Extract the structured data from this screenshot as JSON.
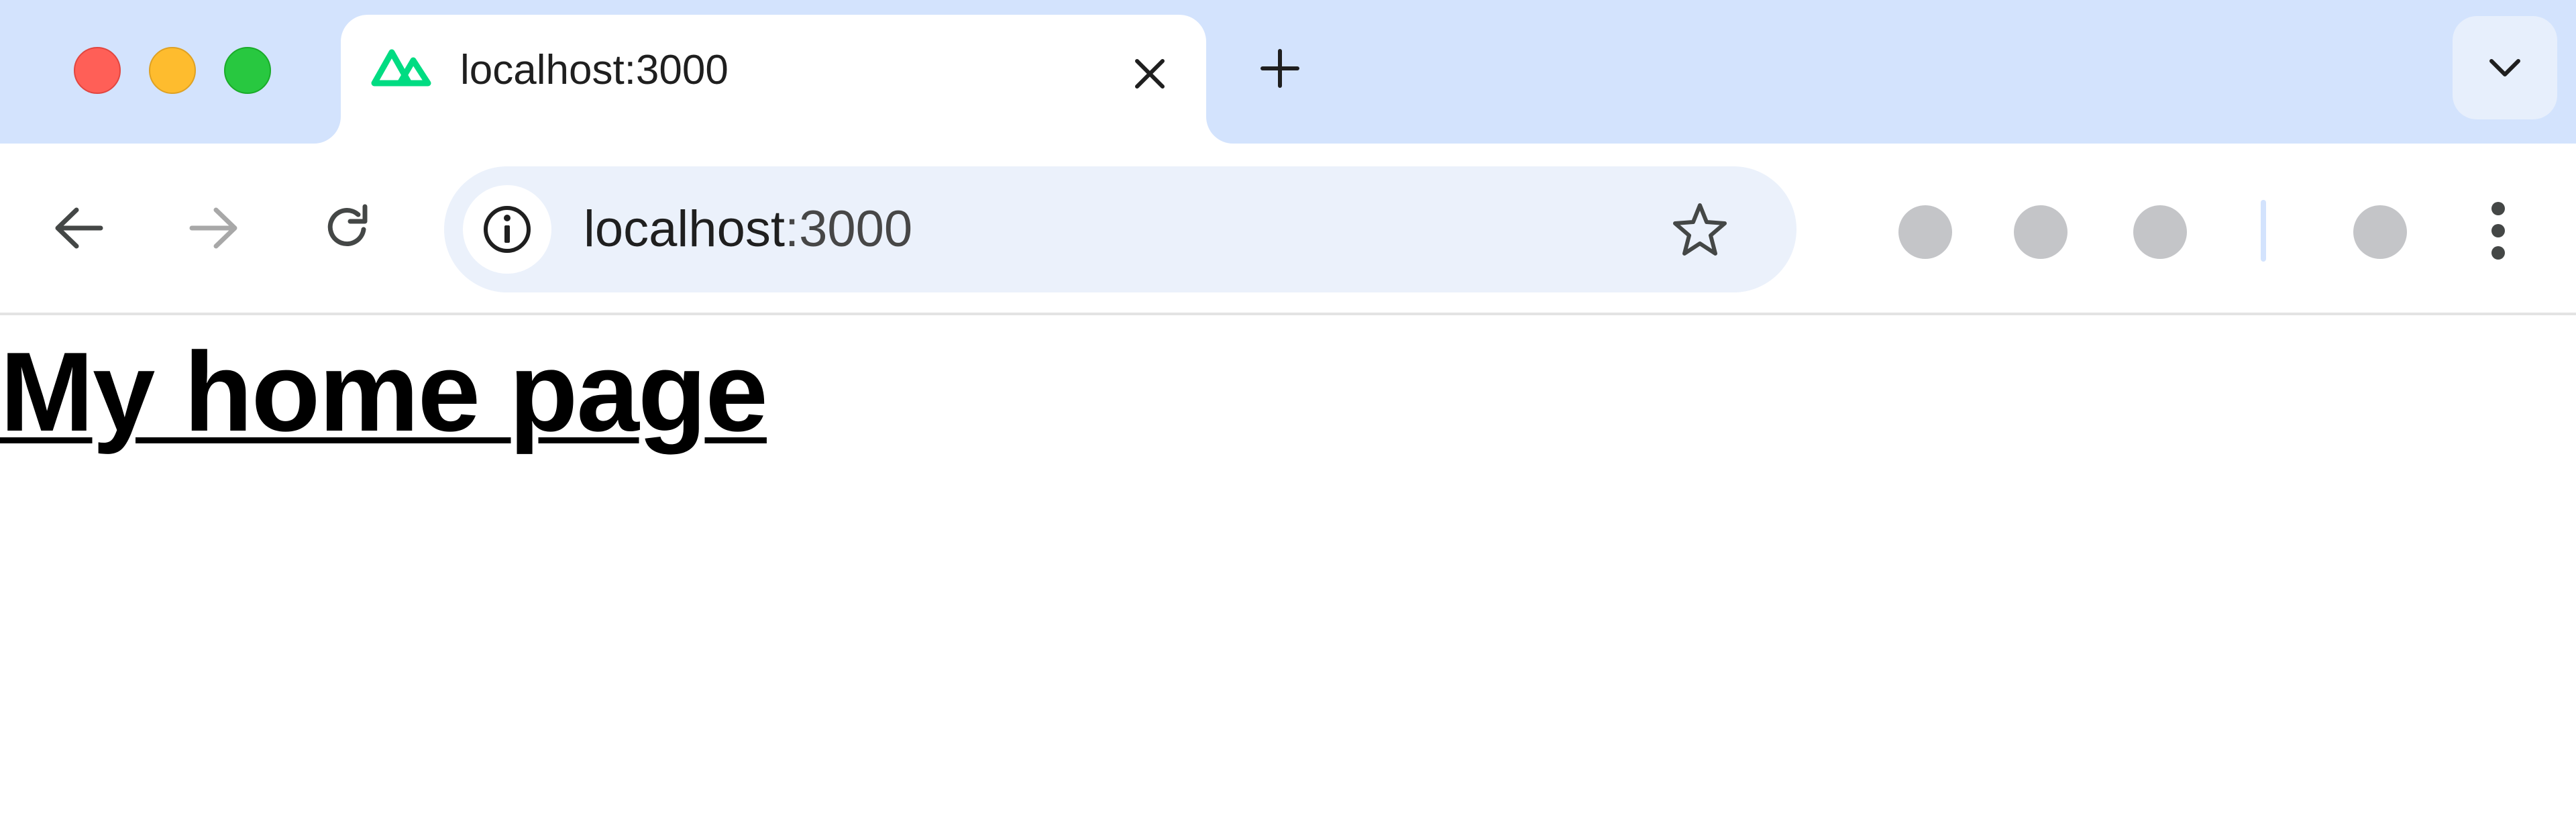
{
  "window": {
    "traffic_lights": [
      "close",
      "minimize",
      "maximize"
    ],
    "colors": {
      "tabstrip_bg": "#d3e3fd",
      "close": "#ff5f57",
      "minimize": "#febc2e",
      "maximize": "#28c840",
      "omnibox_bg": "#ebf1fb",
      "favicon": "#00dc82"
    }
  },
  "tabs": [
    {
      "title": "localhost:3000",
      "favicon": "nuxt-logo-icon",
      "active": true
    }
  ],
  "toolbar": {
    "back_icon": "arrow-left-icon",
    "forward_icon": "arrow-right-icon",
    "reload_icon": "reload-icon",
    "site_info_icon": "info-icon",
    "bookmark_icon": "star-icon",
    "menu_icon": "kebab-menu-icon",
    "extensions": [
      "extension-icon",
      "extension-icon",
      "extension-icon",
      "profile-icon"
    ]
  },
  "omnibox": {
    "host": "localhost",
    "port": ":3000"
  },
  "page": {
    "heading": "My home page"
  }
}
